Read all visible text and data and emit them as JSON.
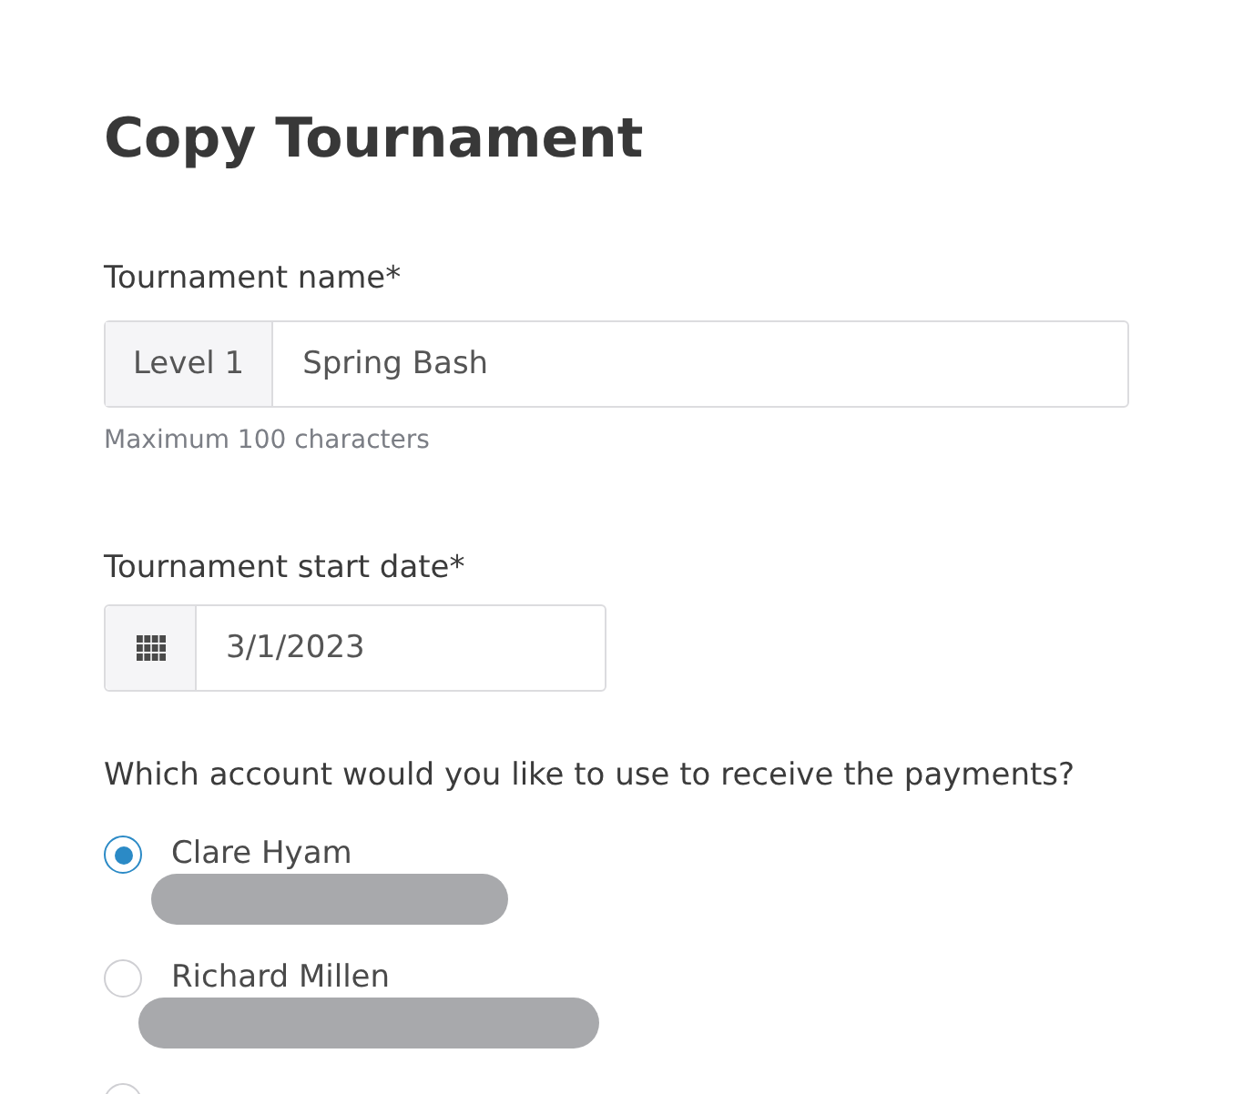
{
  "title": "Copy Tournament",
  "name_field": {
    "label": "Tournament name*",
    "prefix": "Level 1",
    "value": "Spring Bash",
    "hint": "Maximum 100 characters"
  },
  "date_field": {
    "label": "Tournament start date*",
    "value": "3/1/2023"
  },
  "payment_account": {
    "question": "Which account would you like to use to receive the payments?",
    "options": [
      {
        "label": "Clare Hyam",
        "selected": true,
        "redacted": true
      },
      {
        "label": "Richard Millen",
        "selected": false,
        "redacted": true
      },
      {
        "selected": false,
        "redacted": false
      }
    ]
  }
}
